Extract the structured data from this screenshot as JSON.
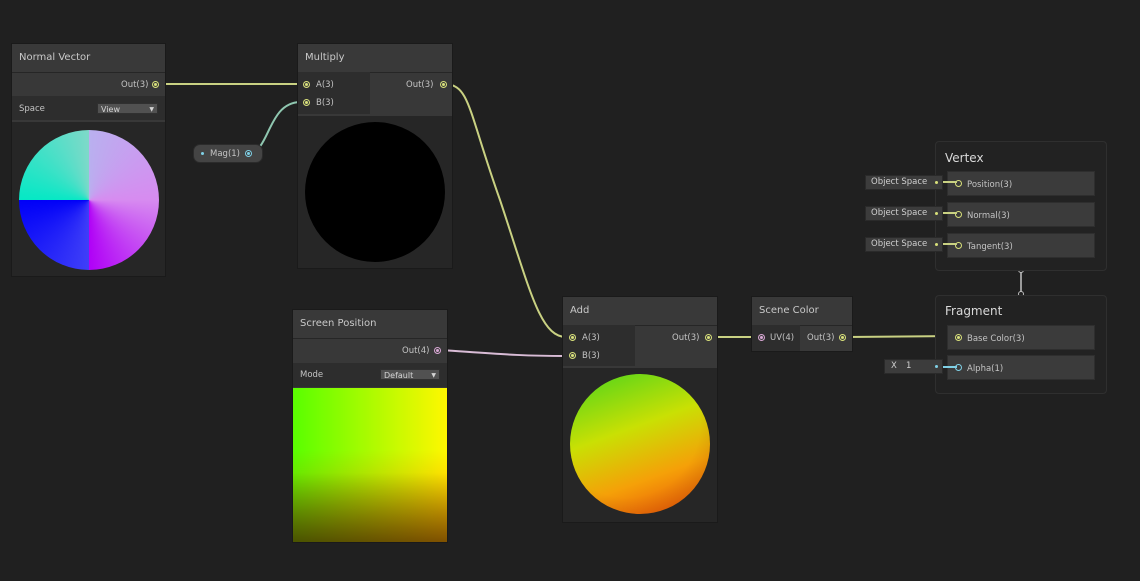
{
  "colors": {
    "background": "#202020",
    "wire_vector3": "#c9d182",
    "wire_float": "#8fc7b0",
    "wire_vector4": "#d9bcd6",
    "port_vector3": "#d8e07a",
    "port_vector4": "#d7a6d3",
    "port_float": "#7fd0e6"
  },
  "nodes": {
    "normal_vector": {
      "title": "Normal Vector",
      "out_label": "Out(3)",
      "space_label": "Space",
      "space_value": "View"
    },
    "multiply": {
      "title": "Multiply",
      "a_label": "A(3)",
      "b_label": "B(3)",
      "out_label": "Out(3)"
    },
    "mag_property": {
      "label": "Mag(1)"
    },
    "screen_position": {
      "title": "Screen Position",
      "out_label": "Out(4)",
      "mode_label": "Mode",
      "mode_value": "Default"
    },
    "add": {
      "title": "Add",
      "a_label": "A(3)",
      "b_label": "B(3)",
      "out_label": "Out(3)"
    },
    "scene_color": {
      "title": "Scene Color",
      "uv_label": "UV(4)",
      "out_label": "Out(3)"
    }
  },
  "master_stack": {
    "vertex": {
      "title": "Vertex",
      "blocks": [
        {
          "label": "Position(3)",
          "input": "Object Space",
          "icon": "vector3-port"
        },
        {
          "label": "Normal(3)",
          "input": "Object Space",
          "icon": "vector3-port"
        },
        {
          "label": "Tangent(3)",
          "input": "Object Space",
          "icon": "vector3-port"
        }
      ]
    },
    "fragment": {
      "title": "Fragment",
      "blocks": [
        {
          "label": "Base Color(3)",
          "icon": "vector3-port"
        },
        {
          "label": "Alpha(1)",
          "input_axis": "X",
          "input_value": "1",
          "icon": "float-port"
        }
      ]
    }
  }
}
